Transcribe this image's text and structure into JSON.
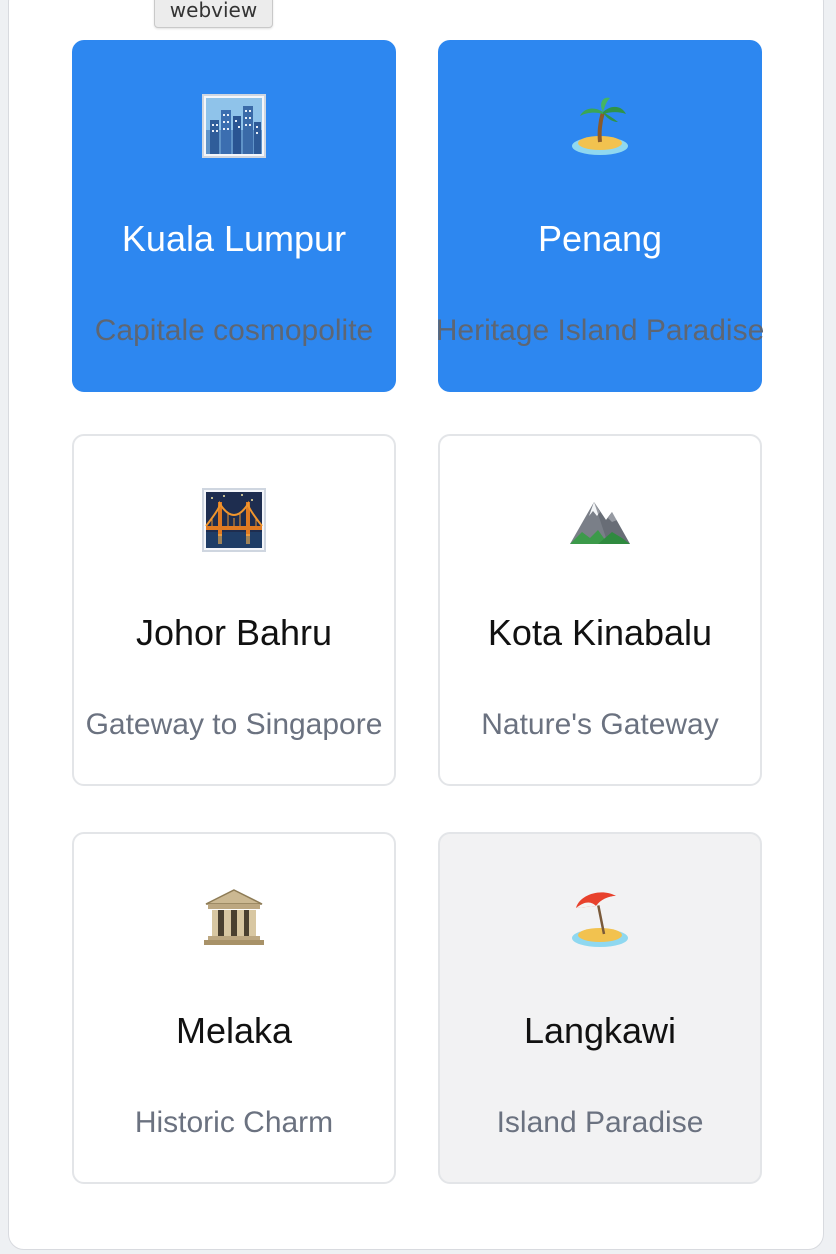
{
  "tooltip": {
    "text": "webview"
  },
  "colors": {
    "selected_bg": "#2d87f0",
    "card_border": "#e3e5e8",
    "hover_bg": "#f2f2f3",
    "tagline": "#6b7280"
  },
  "cities": [
    {
      "icon": "cityscape-icon",
      "name": "Kuala Lumpur",
      "tagline": "Capitale cosmopolite",
      "state": "selected"
    },
    {
      "icon": "desert-island-icon",
      "name": "Penang",
      "tagline": "Heritage Island Paradise",
      "state": "selected"
    },
    {
      "icon": "bridge-at-night-icon",
      "name": "Johor Bahru",
      "tagline": "Gateway to Singapore",
      "state": "default"
    },
    {
      "icon": "mountain-icon",
      "name": "Kota Kinabalu",
      "tagline": "Nature's Gateway",
      "state": "default"
    },
    {
      "icon": "classical-building-icon",
      "name": "Melaka",
      "tagline": "Historic Charm",
      "state": "default"
    },
    {
      "icon": "beach-umbrella-icon",
      "name": "Langkawi",
      "tagline": "Island Paradise",
      "state": "hovered"
    }
  ]
}
